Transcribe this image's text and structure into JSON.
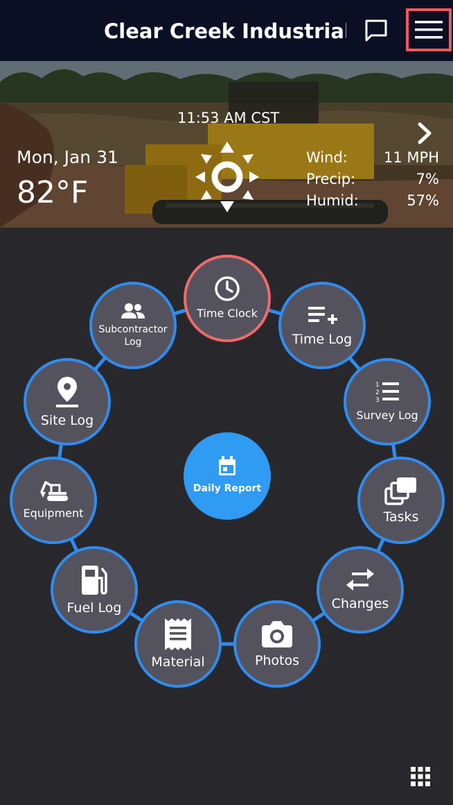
{
  "header": {
    "title": "Clear Creek Industrial …"
  },
  "weather": {
    "time": "11:53 AM CST",
    "date": "Mon, Jan 31",
    "temperature": "82°F",
    "stats": [
      {
        "label": "Wind:",
        "value": "11 MPH"
      },
      {
        "label": "Precip:",
        "value": "7%"
      },
      {
        "label": "Humid:",
        "value": "57%"
      }
    ]
  },
  "dial": {
    "center": "Daily Report",
    "items": [
      {
        "label": "Time Clock",
        "icon": "clock-icon"
      },
      {
        "label": "Time Log",
        "icon": "playlist-add-icon"
      },
      {
        "label": "Survey Log",
        "icon": "numbered-list-icon"
      },
      {
        "label": "Tasks",
        "icon": "stacked-cards-icon"
      },
      {
        "label": "Changes",
        "icon": "swap-arrows-icon"
      },
      {
        "label": "Photos",
        "icon": "camera-icon"
      },
      {
        "label": "Material",
        "icon": "receipt-icon"
      },
      {
        "label": "Fuel Log",
        "icon": "fuel-pump-icon"
      },
      {
        "label": "Equipment",
        "icon": "excavator-icon"
      },
      {
        "label": "Site Log",
        "icon": "map-pin-icon"
      },
      {
        "label": "Subcontractor\nLog",
        "icon": "group-icon"
      }
    ]
  },
  "colors": {
    "header_bg": "#0b0f24",
    "body_bg": "#28282c",
    "node_bg": "#54535d",
    "accent_blue": "#2f8cf0",
    "time_clock_border": "#f06a6a",
    "highlight": "#f05a5a"
  }
}
